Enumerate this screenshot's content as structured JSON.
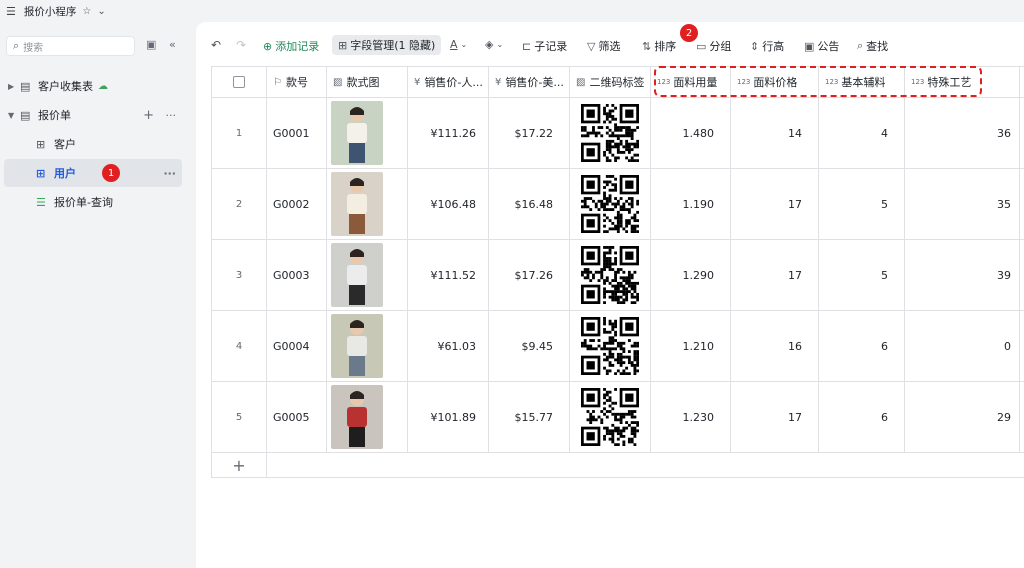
{
  "app": {
    "title": "报价小程序"
  },
  "sidebar": {
    "search_placeholder": "搜索",
    "items": [
      {
        "label": "客户收集表"
      },
      {
        "label": "报价单"
      },
      {
        "label": "客户"
      },
      {
        "label": "用户",
        "badge": "1"
      },
      {
        "label": "报价单-查询"
      }
    ]
  },
  "toolbar": {
    "add_record": "添加记录",
    "field_manage": "字段管理(1 隐藏)",
    "subrecord": "子记录",
    "filter": "筛选",
    "sort": "排序",
    "group": "分组",
    "row_height": "行高",
    "notice": "公告",
    "find": "查找",
    "badge": "2"
  },
  "table": {
    "columns": [
      "款号",
      "款式图",
      "销售价-人...",
      "销售价-美...",
      "二维码标签",
      "面料用量",
      "面料价格",
      "基本辅料",
      "特殊工艺"
    ],
    "rows": [
      {
        "index": "1",
        "code": "G0001",
        "rmb": "¥111.26",
        "usd": "$17.22",
        "usage": "1.480",
        "price": "14",
        "aux": "4",
        "special": "36"
      },
      {
        "index": "2",
        "code": "G0002",
        "rmb": "¥106.48",
        "usd": "$16.48",
        "usage": "1.190",
        "price": "17",
        "aux": "5",
        "special": "35"
      },
      {
        "index": "3",
        "code": "G0003",
        "rmb": "¥111.52",
        "usd": "$17.26",
        "usage": "1.290",
        "price": "17",
        "aux": "5",
        "special": "39"
      },
      {
        "index": "4",
        "code": "G0004",
        "rmb": "¥61.03",
        "usd": "$9.45",
        "usage": "1.210",
        "price": "16",
        "aux": "6",
        "special": "0"
      },
      {
        "index": "5",
        "code": "G0005",
        "rmb": "¥101.89",
        "usd": "$15.77",
        "usage": "1.230",
        "price": "17",
        "aux": "6",
        "special": "29"
      }
    ]
  },
  "colors": {
    "accent": "#245bdb",
    "add_green": "#1f8a5a",
    "badge_red": "#e02020"
  }
}
